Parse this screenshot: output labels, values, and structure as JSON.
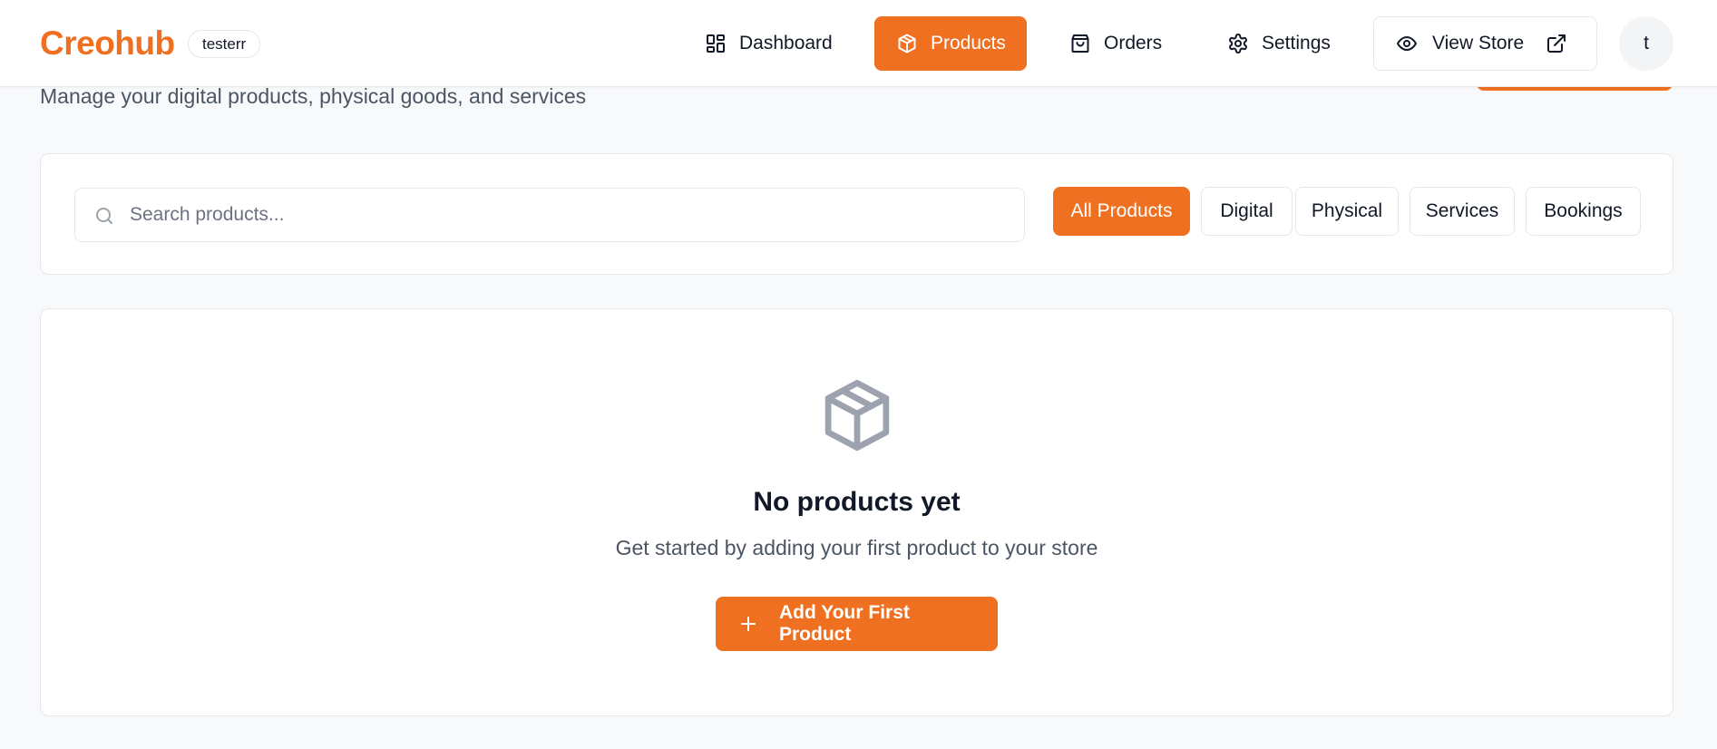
{
  "header": {
    "brand": "Creohub",
    "store_badge": "testerr",
    "nav": {
      "dashboard": {
        "label": "Dashboard",
        "icon": "dashboard-grid-icon"
      },
      "products": {
        "label": "Products",
        "icon": "package-icon",
        "active": true
      },
      "orders": {
        "label": "Orders",
        "icon": "shopping-bag-icon"
      },
      "settings": {
        "label": "Settings",
        "icon": "gear-icon"
      }
    },
    "view_store": {
      "label": "View Store",
      "icon": "eye-icon",
      "trailing_icon": "external-link-icon"
    },
    "avatar_initial": "t"
  },
  "page": {
    "subtitle": "Manage your digital products, physical goods, and services"
  },
  "filters": {
    "search_placeholder": "Search products...",
    "search_value": "",
    "tabs": [
      "All Products",
      "Digital",
      "Physical",
      "Services",
      "Bookings"
    ],
    "active_tab": "All Products"
  },
  "empty_state": {
    "icon": "package-icon",
    "title": "No products yet",
    "subtitle": "Get started by adding your first product to your store",
    "button_label": "Add Your First Product",
    "button_icon": "plus-icon"
  },
  "colors": {
    "accent": "#ee7020",
    "background": "#f8f9fb",
    "text": "#111827",
    "muted_text": "#4b5563",
    "border": "#e5e7eb",
    "empty_icon": "#9ca3af"
  }
}
